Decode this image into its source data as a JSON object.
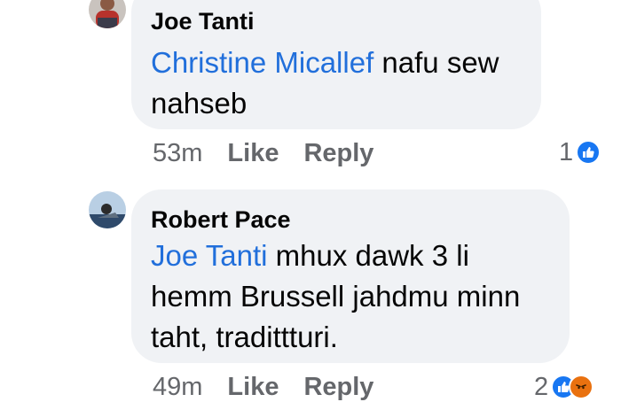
{
  "comments": [
    {
      "author": "Joe Tanti",
      "mention": "Christine Micallef",
      "text_line1": " nafu sew",
      "text_line2": "nahseb",
      "time": "53m",
      "like_label": "Like",
      "reply_label": "Reply",
      "reaction_count": "1",
      "reactions": [
        "like-icon"
      ]
    },
    {
      "author": "Robert Pace",
      "mention": "Joe Tanti",
      "text_line1": " mhux dawk 3 li",
      "text_line2": "hemm Brussell jahdmu minn",
      "text_line3": "taht, tradittturi.",
      "time": "49m",
      "like_label": "Like",
      "reply_label": "Reply",
      "reaction_count": "2",
      "reactions": [
        "like-icon",
        "angry-icon"
      ]
    }
  ],
  "colors": {
    "mention": "#216fdb",
    "bubble": "#f0f2f5",
    "meta": "#65676b",
    "like_reaction": "#1877f2",
    "angry_reaction": "#e9710f"
  }
}
